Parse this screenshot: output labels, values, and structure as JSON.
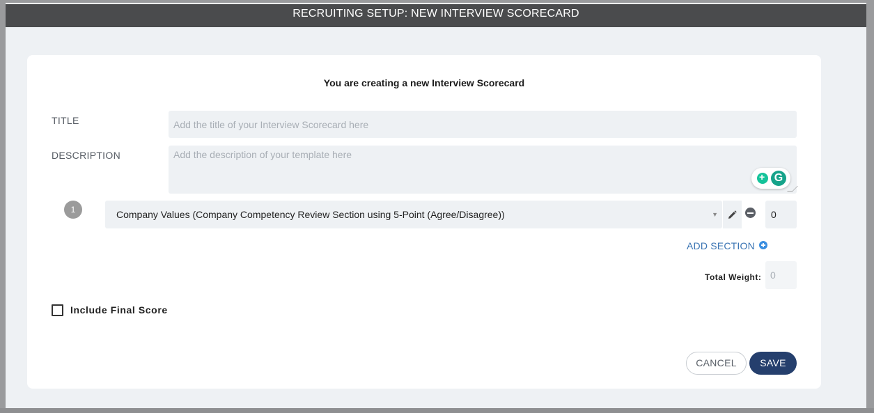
{
  "header": {
    "title": "RECRUITING SETUP: NEW INTERVIEW SCORECARD"
  },
  "form": {
    "subtitle": "You are creating a new Interview Scorecard",
    "title_label": "TITLE",
    "title_placeholder": "Add the title of your Interview Scorecard here",
    "title_value": "",
    "description_label": "DESCRIPTION",
    "description_placeholder": "Add the description of your template here",
    "description_value": ""
  },
  "sections": [
    {
      "number": "1",
      "selected": "Company Values (Company Competency Review Section using 5-Point (Agree/Disagree))",
      "weight": "0"
    }
  ],
  "add_section_label": "ADD SECTION",
  "total_weight": {
    "label": "Total Weight:",
    "value": "0"
  },
  "include_final_score": {
    "label": "Include Final Score",
    "checked": false
  },
  "buttons": {
    "cancel": "CANCEL",
    "save": "SAVE"
  },
  "icons": {
    "edit": "pencil-icon",
    "remove": "minus-circle-icon",
    "add": "plus-circle-icon",
    "dropdown": "caret-down-icon",
    "grammarly": "grammarly-icon"
  },
  "colors": {
    "header_bg": "#4a4b4d",
    "accent_link": "#3a74b3",
    "primary_button": "#253f6d",
    "input_bg": "#eef1f4"
  }
}
